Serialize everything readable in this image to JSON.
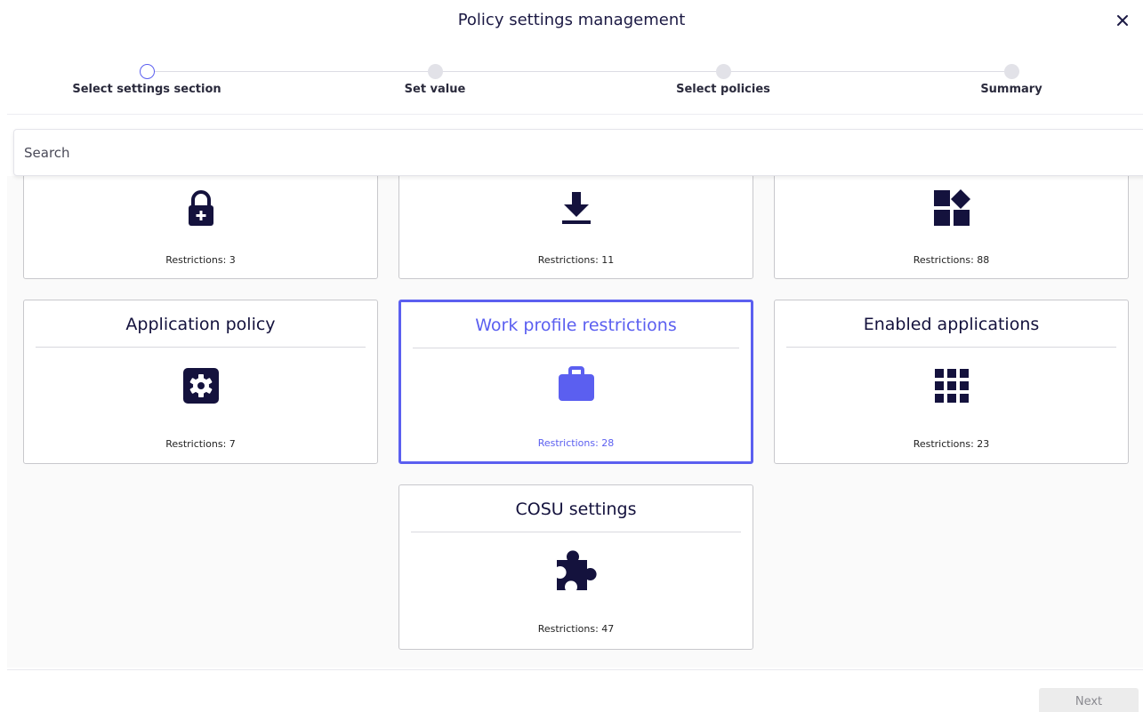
{
  "dialog": {
    "title": "Policy settings management"
  },
  "stepper": {
    "steps": [
      {
        "label": "Select settings section",
        "active": true
      },
      {
        "label": "Set value",
        "active": false
      },
      {
        "label": "Select policies",
        "active": false
      },
      {
        "label": "Summary",
        "active": false
      }
    ]
  },
  "search": {
    "placeholder": "Search",
    "value": ""
  },
  "cards": [
    {
      "title": "",
      "icon": "lock-plus-icon",
      "restrictions": "Restrictions: 3"
    },
    {
      "title": "",
      "icon": "download-icon",
      "restrictions": "Restrictions: 11"
    },
    {
      "title": "",
      "icon": "apps-widgets-icon",
      "restrictions": "Restrictions: 88"
    },
    {
      "title": "Application policy",
      "icon": "gear-square-icon",
      "restrictions": "Restrictions: 7"
    },
    {
      "title": "Work profile restrictions",
      "icon": "briefcase-icon",
      "restrictions": "Restrictions: 28",
      "selected": true
    },
    {
      "title": "Enabled applications",
      "icon": "grid-apps-icon",
      "restrictions": "Restrictions: 23"
    },
    {
      "title": "COSU settings",
      "icon": "puzzle-icon",
      "restrictions": "Restrictions: 47"
    }
  ],
  "footer": {
    "next_label": "Next"
  },
  "colors": {
    "accent": "#5b5ff0",
    "icon": "#14123d",
    "text": "#14123d"
  }
}
